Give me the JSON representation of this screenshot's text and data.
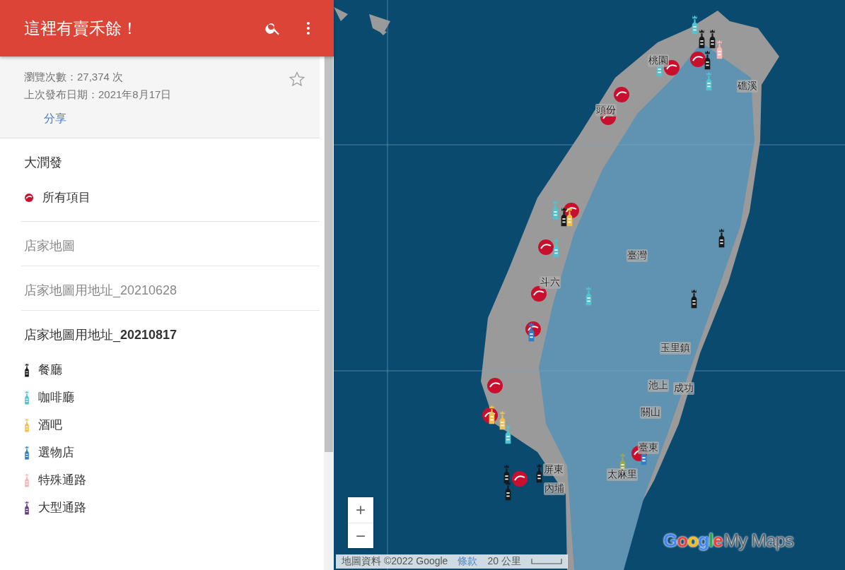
{
  "header": {
    "title": "這裡有賣禾餘！"
  },
  "info": {
    "views": "瀏覽次數：27,374 次",
    "published": "上次發布日期：2021年8月17日",
    "share": "分享",
    "starred": false
  },
  "layers": [
    {
      "title": "大潤發",
      "visible": true,
      "items": [
        {
          "label": "所有項目",
          "kind": "circle",
          "color": "#c8102e"
        }
      ]
    },
    {
      "title": "店家地圖",
      "visible": false
    },
    {
      "title": "店家地圖用地址_20210628",
      "visible": false
    },
    {
      "title": "店家地圖用地址_**20210817**",
      "visible": true,
      "items": [
        {
          "label": "餐廳",
          "kind": "bottle",
          "color": "#1a1a1a"
        },
        {
          "label": "咖啡廳",
          "kind": "bottle",
          "color": "#4fc3d0"
        },
        {
          "label": "酒吧",
          "kind": "bottle",
          "color": "#f0c050"
        },
        {
          "label": "選物店",
          "kind": "bottle",
          "color": "#2f7fc8"
        },
        {
          "label": "特殊通路",
          "kind": "bottle",
          "color": "#f4b8b8"
        },
        {
          "label": "大型通路",
          "kind": "bottle",
          "color": "#6a3a8a"
        }
      ]
    }
  ],
  "map": {
    "places": [
      "桃園",
      "礁溪",
      "頭份",
      "臺灣",
      "斗六",
      "玉里鎮",
      "池上",
      "成功",
      "關山",
      "臺東",
      "屏東",
      "內埔",
      "太麻里"
    ],
    "zoom_in": "+",
    "zoom_out": "−",
    "attribution": {
      "data": "地圖資料 ©2022 Google",
      "terms": "條款",
      "scale": "20 公里"
    },
    "logo": {
      "brand": "Google",
      "product": "My Maps"
    }
  }
}
